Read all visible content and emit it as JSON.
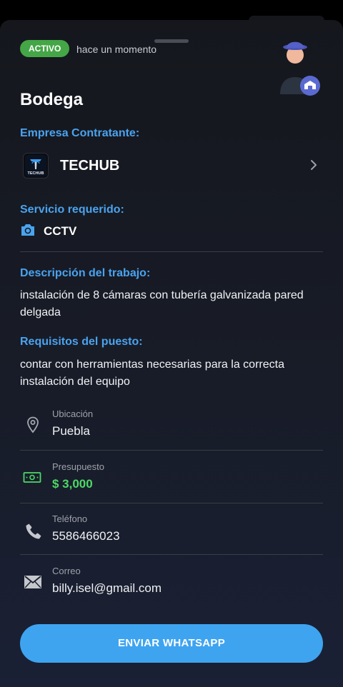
{
  "status": {
    "badge": "ACTIVO",
    "badge_color": "#44a646",
    "time": "hace un momento"
  },
  "job": {
    "title": "Bodega"
  },
  "colors": {
    "accent": "#4aa3ef",
    "money": "#4cd964",
    "button": "#3ea4f0"
  },
  "company": {
    "section_label": "Empresa Contratante:",
    "name": "TECHUB",
    "logo_text": "TECHUB",
    "logo_icon": "techub-logo",
    "chevron_icon": "chevron-right-icon"
  },
  "service": {
    "section_label": "Servicio requerido:",
    "name": "CCTV",
    "icon": "camera-icon"
  },
  "description": {
    "section_label": "Descripción del trabajo:",
    "text": "instalación de 8 cámaras con tubería galvanizada pared delgada"
  },
  "requirements": {
    "section_label": "Requisitos del puesto:",
    "text": "contar con herramientas necesarias para la correcta instalación del equipo"
  },
  "details": {
    "location": {
      "label": "Ubicación",
      "value": "Puebla",
      "icon": "location-pin-icon"
    },
    "budget": {
      "label": "Presupuesto",
      "value": "$ 3,000",
      "icon": "money-icon"
    },
    "phone": {
      "label": "Teléfono",
      "value": "5586466023",
      "icon": "phone-icon"
    },
    "email": {
      "label": "Correo",
      "value": "billy.isel@gmail.com",
      "icon": "mail-icon"
    }
  },
  "actions": {
    "whatsapp_label": "ENVIAR WHATSAPP"
  }
}
